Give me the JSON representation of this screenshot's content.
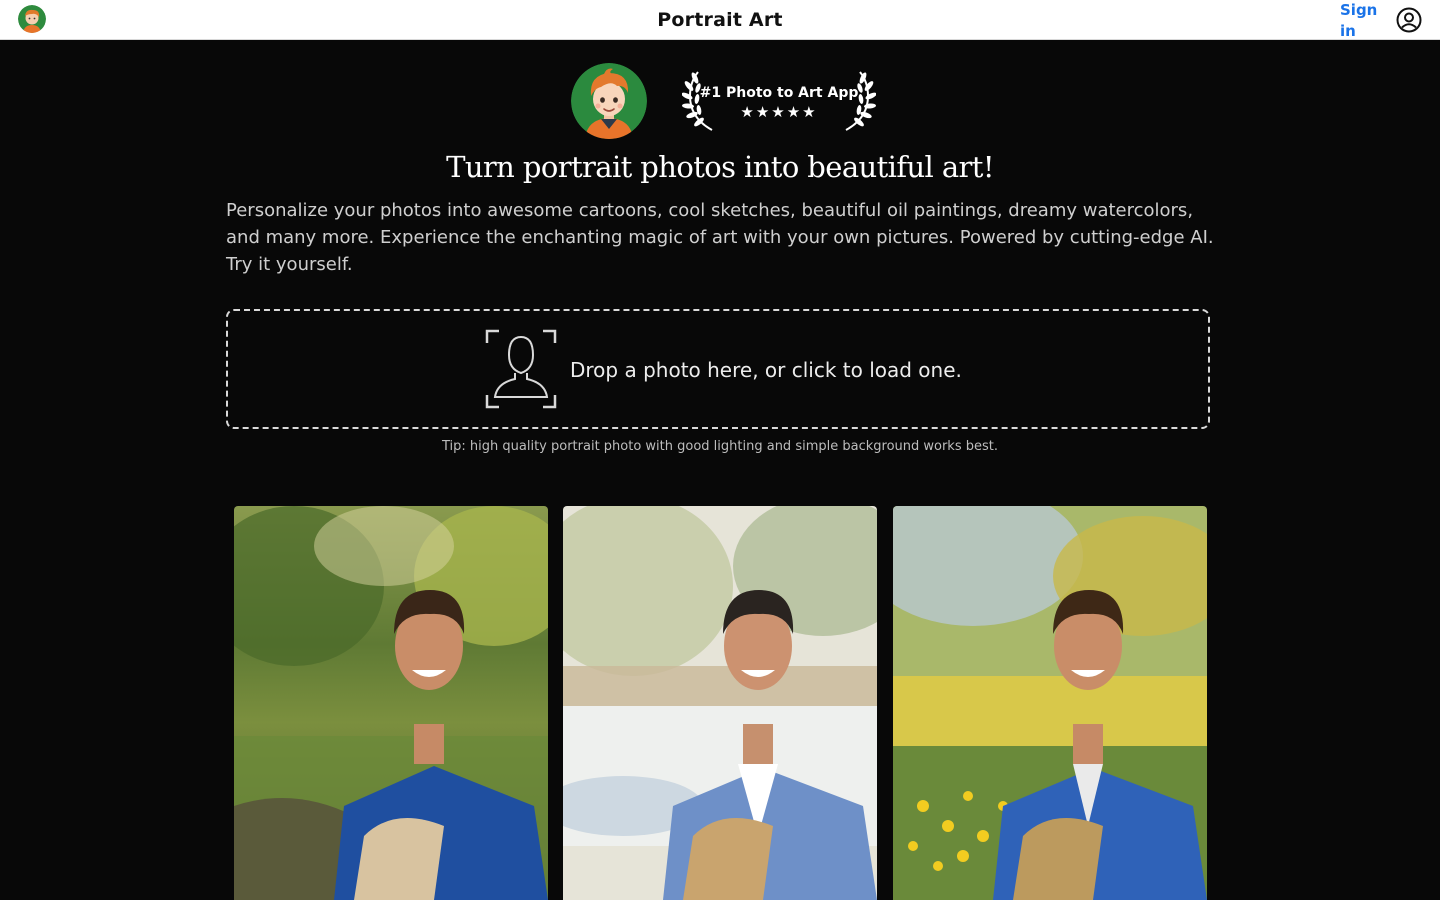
{
  "header": {
    "title": "Portrait Art",
    "signin_label": "Sign in"
  },
  "hero": {
    "award_text": "#1 Photo to Art App",
    "stars": "★★★★★",
    "rating_stars": 5,
    "headline": "Turn portrait photos into beautiful art!",
    "description": "Personalize your photos into awesome cartoons, cool sketches, beautiful oil paintings, dreamy watercolors, and many more. Experience the enchanting magic of art with your own pictures. Powered by cutting-edge AI. Try it yourself."
  },
  "upload": {
    "prompt": "Drop a photo here, or click to load one.",
    "tip": "Tip: high quality portrait photo with good lighting and simple background works best."
  },
  "gallery": [
    {
      "style": "photo",
      "icon": "original-photo"
    },
    {
      "style": "watercolor",
      "icon": "watercolor-painting"
    },
    {
      "style": "oil-painting",
      "icon": "oil-painting"
    }
  ],
  "colors": {
    "background": "#080808",
    "accent_link": "#1a73e8",
    "header_bg": "#ffffff"
  }
}
